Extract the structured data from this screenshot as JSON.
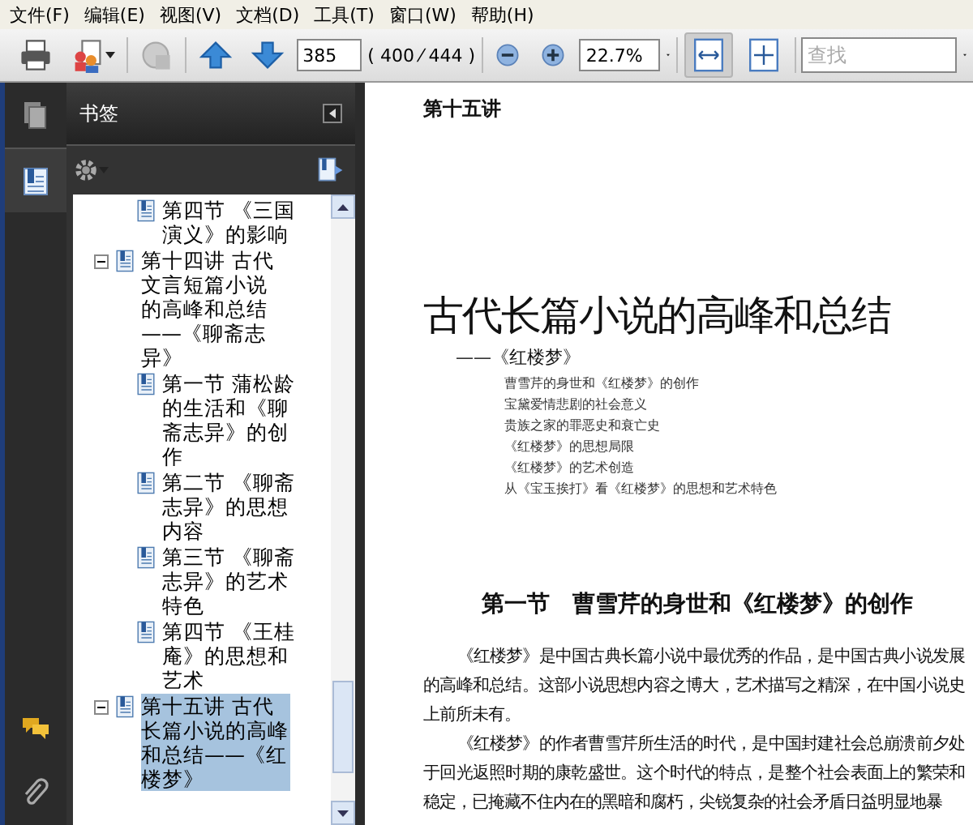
{
  "menu": [
    "文件(F)",
    "编辑(E)",
    "视图(V)",
    "文档(D)",
    "工具(T)",
    "窗口(W)",
    "帮助(H)"
  ],
  "toolbar": {
    "page": "385",
    "page_count": "( 400 ⁄ 444 )",
    "zoom": "22.7%",
    "search": {
      "placeholder": "查找"
    },
    "fit_width_selected": true,
    "fit_page_selected": false
  },
  "side_tabs": [
    {
      "kind": "pages",
      "selected": false
    },
    {
      "kind": "bookmarks",
      "selected": true
    },
    {
      "kind": "comments",
      "selected": false
    },
    {
      "kind": "attachments",
      "selected": false
    }
  ],
  "bookmarks": {
    "title": "书签",
    "continued": [
      {
        "label": "第四节 《三国演义》的影响"
      }
    ],
    "items": [
      {
        "label": "第十四讲 古代文言短篇小说的高峰和总结——《聊斋志异》",
        "expanded": true,
        "selected": false,
        "children": [
          {
            "label": "第一节 蒲松龄的生活和《聊斋志异》的创作"
          },
          {
            "label": "第二节 《聊斋志异》的思想内容"
          },
          {
            "label": "第三节 《聊斋志异》的艺术特色"
          },
          {
            "label": "第四节 《王桂庵》的思想和艺术"
          }
        ]
      },
      {
        "label": "第十五讲 古代长篇小说的高峰和总结——《红楼梦》",
        "expanded": true,
        "selected": true
      }
    ]
  },
  "document": {
    "running_head": "第十五讲",
    "title": "古代长篇小说的高峰和总结",
    "subtitle": "——《红楼梦》",
    "contents": [
      "曹雪芹的身世和《红楼梦》的创作",
      "宝黛爱情悲剧的社会意义",
      "贵族之家的罪恶史和衰亡史",
      "《红楼梦》的思想局限",
      "《红楼梦》的艺术创造",
      "从《宝玉挨打》看《红楼梦》的思想和艺术特色"
    ],
    "section_heading": "第一节　曹雪芹的身世和《红楼梦》的创作",
    "paragraphs": [
      "《红楼梦》是中国古典长篇小说中最优秀的作品，是中国古典小说发展的高峰和总结。这部小说思想内容之博大，艺术描写之精深，在中国小说史上前所未有。",
      "《红楼梦》的作者曹雪芹所生活的时代，是中国封建社会总崩溃前夕处于回光返照时期的康乾盛世。这个时代的特点，是整个社会表面上的繁荣和稳定，已掩藏不住内在的黑暗和腐朽，尖锐复杂的社会矛盾日益明显地暴"
    ]
  }
}
